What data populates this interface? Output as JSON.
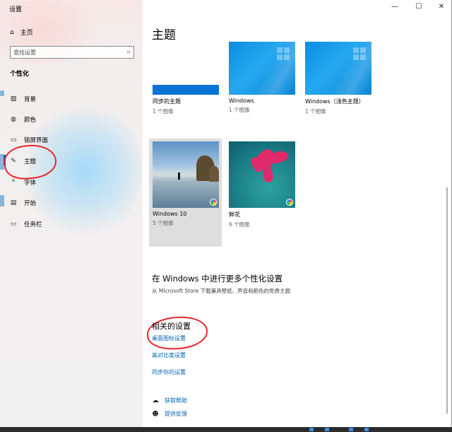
{
  "window": {
    "title": "设置"
  },
  "sidebar": {
    "home_label": "主页",
    "search_placeholder": "查找设置",
    "section_title": "个性化",
    "items": [
      {
        "label": "背景",
        "icon": "image-icon"
      },
      {
        "label": "颜色",
        "icon": "palette-icon"
      },
      {
        "label": "锁屏界面",
        "icon": "lock-screen-icon"
      },
      {
        "label": "主题",
        "icon": "theme-icon",
        "active": true
      },
      {
        "label": "字体",
        "icon": "font-icon"
      },
      {
        "label": "开始",
        "icon": "start-icon"
      },
      {
        "label": "任务栏",
        "icon": "taskbar-icon"
      }
    ]
  },
  "main": {
    "heading": "主题",
    "themes": [
      {
        "name": "同步的主题",
        "count": "1 个图像"
      },
      {
        "name": "Windows",
        "count": "1 个图像"
      },
      {
        "name": "Windows（浅色主题）",
        "count": "1 个图像"
      },
      {
        "name": "Windows 10",
        "count": "5 个图像",
        "selected": true
      },
      {
        "name": "鲜花",
        "count": "6 个图像"
      }
    ],
    "more": {
      "title": "在 Windows 中进行更多个性化设置",
      "description": "从 Microsoft Store 下载兼具壁纸、声音和颜色的免费主题"
    },
    "related": {
      "title": "相关的设置",
      "links": [
        "桌面图标设置",
        "高对比度设置",
        "同步你的设置"
      ]
    },
    "help": {
      "get_help": "获取帮助",
      "feedback": "提供反馈"
    }
  },
  "colors": {
    "accent": "#0063b1",
    "annotation": "#e8252a"
  }
}
